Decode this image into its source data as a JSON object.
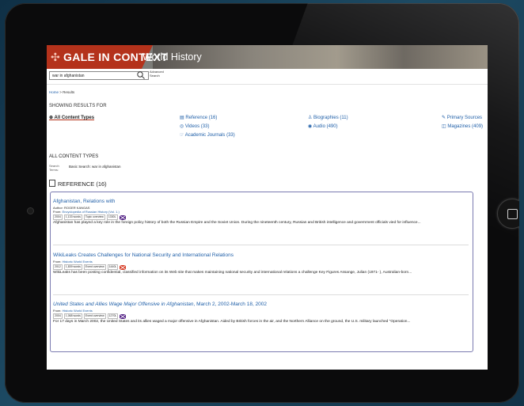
{
  "header": {
    "brand": "GALE IN CONTEXT",
    "product": "World History"
  },
  "search": {
    "value": "war in afghanistan",
    "advanced": "Advanced Search"
  },
  "breadcrumb": {
    "home": "Home",
    "sep": " > ",
    "current": "Results"
  },
  "showing_label": "SHOWING RESULTS FOR",
  "filters": {
    "all": "All Content Types",
    "reference": "Reference (16)",
    "videos": "Videos (33)",
    "academic": "Academic Journals (33)",
    "biographies": "Biographies (11)",
    "audio": "Audio (490)",
    "primary": "Primary Sources",
    "magazines": "Magazines (409)"
  },
  "content_types_heading": "ALL CONTENT TYPES",
  "search_terms": {
    "label": "Search Terms:",
    "value": "Basic Search: war in afghanistan"
  },
  "reference_heading": "REFERENCE (16)",
  "results": [
    {
      "title": "Afghanistan, Relations with",
      "author": "Author: ROGER KANGAS",
      "from_label": "From:",
      "from": "Encyclopedia of Russian History (Vol. 1.)",
      "year": "2004",
      "words": "1,133 words",
      "doc_type": "Topic overview",
      "lexile": "1330L",
      "snippet": "Afghanistan has played a key role in the foreign policy history of both the Russian Empire and the Soviet Union. During the nineteenth century, Russian and British intelligence and government officials vied for influence..."
    },
    {
      "title": "WikiLeaks Creates Challenges for National Security and International Relations",
      "author": "",
      "from_label": "From:",
      "from": "Historic World Events",
      "year": "2012",
      "words": "1,839 words",
      "doc_type": "Event overview",
      "lexile": "1440L",
      "snippet": "WikiLeaks has been posting confidential, classified information on its Web site that makes maintaining national security and international relations a challenge Key Figures Assange, Julian (1971- ), Australian-born..."
    },
    {
      "title": "United States and Allies Wage Major Offensive in Afghanistan",
      "title_suffix": ", March 2, 2002-March 18, 2002",
      "author": "",
      "from_label": "From:",
      "from": "Historic World Events",
      "year": "2004",
      "words": "1,068 words",
      "doc_type": "Event overview",
      "lexile": "1270L",
      "snippet": "For 17 days in March 2002, the United States and its allies waged a major offensive in Afghanistan. Aided by British forces in the air, and the Northern Alliance on the ground, the U.S. military launched \"Operation..."
    }
  ]
}
